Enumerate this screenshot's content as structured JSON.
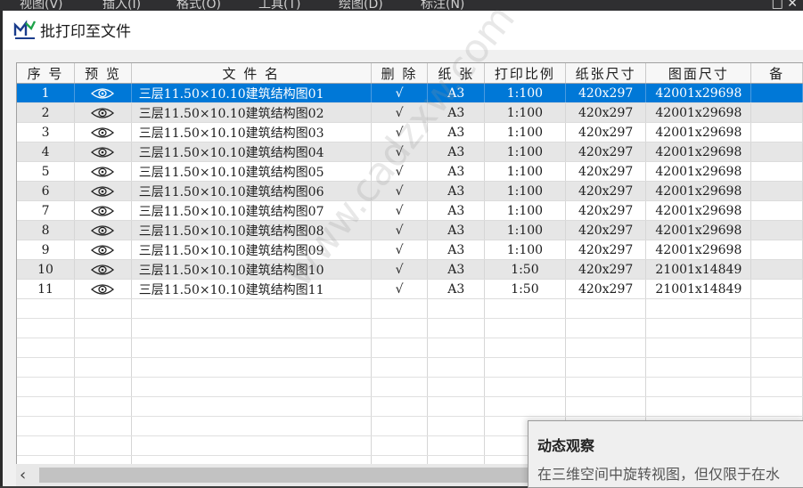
{
  "menu": {
    "items": [
      "视图(V)",
      "插入(I)",
      "格式(O)",
      "工具(T)",
      "绘图(D)",
      "标注(N)"
    ]
  },
  "window_controls": "□ ✕",
  "dialog": {
    "title": "批打印至文件"
  },
  "table": {
    "columns": [
      "序 号",
      "预 览",
      "文 件 名",
      "删 除",
      "纸 张",
      "打印比例",
      "纸张尺寸",
      "图面尺寸",
      "备"
    ],
    "rows": [
      {
        "no": "1",
        "name": "三层11.50×10.10建筑结构图01",
        "del": "√",
        "paper": "A3",
        "scale": "1:100",
        "paper_size": "420x297",
        "drawing_size": "42001x29698",
        "note": ""
      },
      {
        "no": "2",
        "name": "三层11.50×10.10建筑结构图02",
        "del": "√",
        "paper": "A3",
        "scale": "1:100",
        "paper_size": "420x297",
        "drawing_size": "42001x29698",
        "note": ""
      },
      {
        "no": "3",
        "name": "三层11.50×10.10建筑结构图03",
        "del": "√",
        "paper": "A3",
        "scale": "1:100",
        "paper_size": "420x297",
        "drawing_size": "42001x29698",
        "note": ""
      },
      {
        "no": "4",
        "name": "三层11.50×10.10建筑结构图04",
        "del": "√",
        "paper": "A3",
        "scale": "1:100",
        "paper_size": "420x297",
        "drawing_size": "42001x29698",
        "note": ""
      },
      {
        "no": "5",
        "name": "三层11.50×10.10建筑结构图05",
        "del": "√",
        "paper": "A3",
        "scale": "1:100",
        "paper_size": "420x297",
        "drawing_size": "42001x29698",
        "note": ""
      },
      {
        "no": "6",
        "name": "三层11.50×10.10建筑结构图06",
        "del": "√",
        "paper": "A3",
        "scale": "1:100",
        "paper_size": "420x297",
        "drawing_size": "42001x29698",
        "note": ""
      },
      {
        "no": "7",
        "name": "三层11.50×10.10建筑结构图07",
        "del": "√",
        "paper": "A3",
        "scale": "1:100",
        "paper_size": "420x297",
        "drawing_size": "42001x29698",
        "note": ""
      },
      {
        "no": "8",
        "name": "三层11.50×10.10建筑结构图08",
        "del": "√",
        "paper": "A3",
        "scale": "1:100",
        "paper_size": "420x297",
        "drawing_size": "42001x29698",
        "note": ""
      },
      {
        "no": "9",
        "name": "三层11.50×10.10建筑结构图09",
        "del": "√",
        "paper": "A3",
        "scale": "1:100",
        "paper_size": "420x297",
        "drawing_size": "42001x29698",
        "note": ""
      },
      {
        "no": "10",
        "name": "三层11.50×10.10建筑结构图10",
        "del": "√",
        "paper": "A3",
        "scale": "1:50",
        "paper_size": "420x297",
        "drawing_size": "21001x14849",
        "note": ""
      },
      {
        "no": "11",
        "name": "三层11.50×10.10建筑结构图11",
        "del": "√",
        "paper": "A3",
        "scale": "1:50",
        "paper_size": "420x297",
        "drawing_size": "21001x14849",
        "note": ""
      }
    ],
    "selected_row": 0
  },
  "tooltip": {
    "title": "动态观察",
    "body": "在三维空间中旋转视图，但仅限于在水"
  },
  "watermark": "www.cadzxw.com",
  "colors": {
    "selection": "#0078d7",
    "alt_row": "#e6e6e6"
  }
}
